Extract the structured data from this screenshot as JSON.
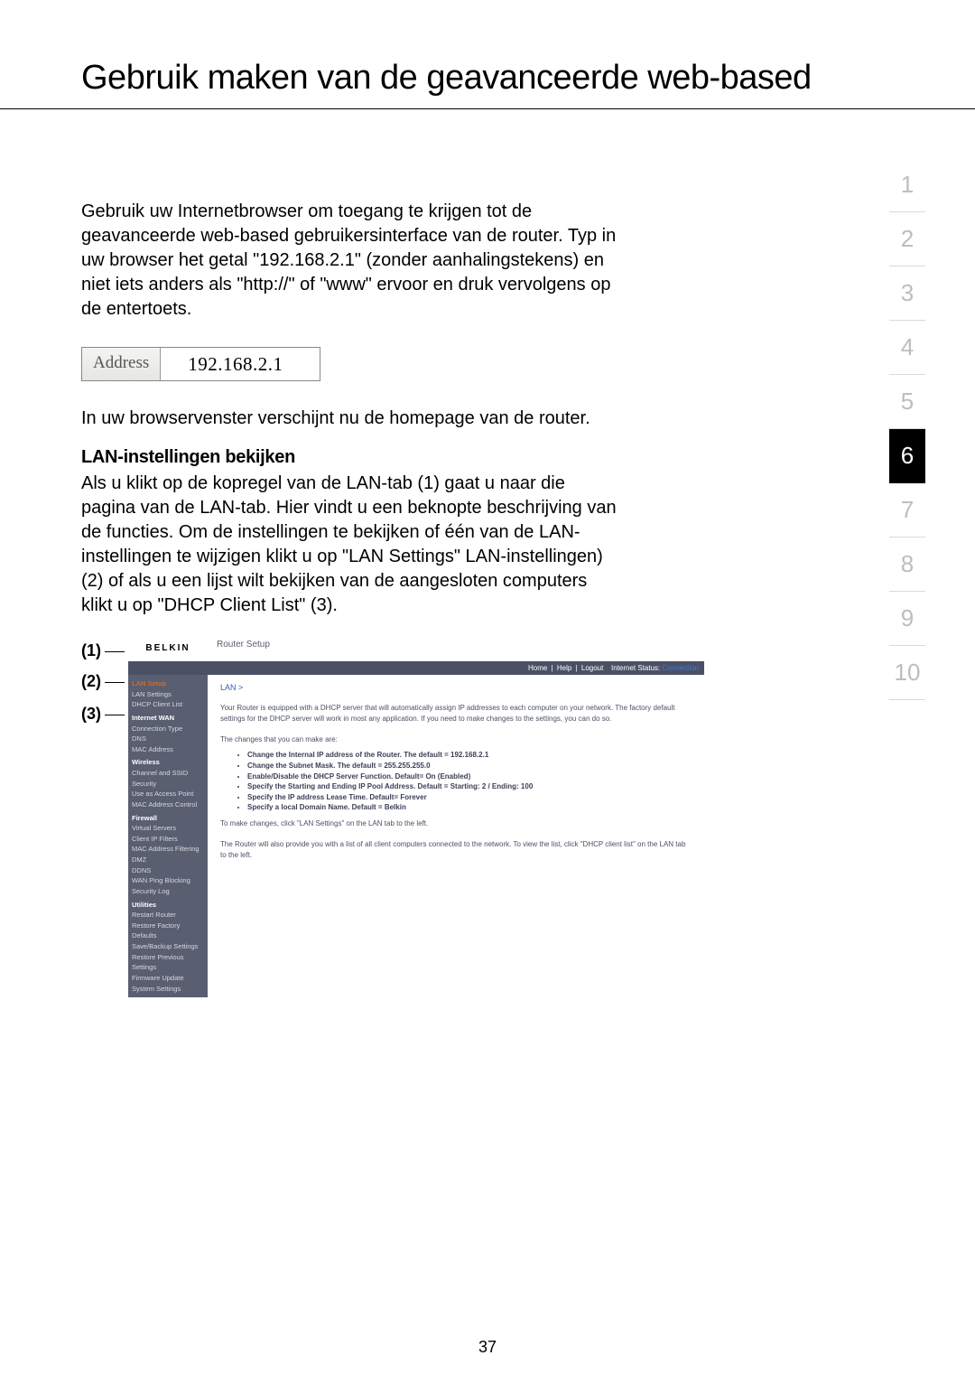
{
  "title": "Gebruik maken van de geavanceerde web-based",
  "intro": "Gebruik uw Internetbrowser om toegang te krijgen tot de geavanceerde web-based gebruikersinterface van de router. Typ in uw browser het getal \"192.168.2.1\" (zonder aanhalingstekens) en niet iets anders als \"http://\" of \"www\" ervoor en druk vervolgens op de entertoets.",
  "address_label": "Address",
  "address_value": "192.168.2.1",
  "after_address": "In uw browservenster verschijnt nu de homepage van de router.",
  "subhead": "LAN-instellingen bekijken",
  "lan_para": "Als u klikt op de kopregel van de LAN-tab (1) gaat u naar die pagina van de LAN-tab. Hier vindt u een beknopte beschrijving van de functies. Om de instellingen te bekijken of één van de LAN-instellingen te wijzigen klikt u op \"LAN Settings\" LAN-instellingen) (2) of als u een lijst wilt bekijken van de aangesloten computers klikt u op \"DHCP Client List\" (3).",
  "nav": [
    "1",
    "2",
    "3",
    "4",
    "5",
    "6",
    "7",
    "8",
    "9",
    "10"
  ],
  "nav_active_index": 5,
  "callouts": [
    "(1)",
    "(2)",
    "(3)"
  ],
  "router": {
    "logo": "BELKIN",
    "setup_title": "Router Setup",
    "topbar_links": [
      "Home",
      "Help",
      "Logout"
    ],
    "topbar_status_label": "Internet Status:",
    "topbar_status_value": "Connection",
    "crumb": "LAN >",
    "desc1": "Your Router is equipped with a DHCP server that will automatically assign IP addresses to each computer on your network. The factory default settings for the DHCP server will work in most any application. If you need to make changes to the settings, you can do so.",
    "desc2": "The changes that you can make are:",
    "bullets": [
      "Change the Internal IP address of the Router. The default = 192.168.2.1",
      "Change the Subnet Mask. The default = 255.255.255.0",
      "Enable/Disable the DHCP Server Function. Default= On (Enabled)",
      "Specify the Starting and Ending IP Pool Address. Default = Starting: 2 / Ending: 100",
      "Specify the IP address Lease Time. Default= Forever",
      "Specify a local Domain Name. Default = Belkin"
    ],
    "desc3": "To make changes, click \"LAN Settings\" on the LAN tab to the left.",
    "desc4": "The Router will also provide you with a list of all client computers connected to the network. To view the list, click \"DHCP client list\" on the LAN tab to the left.",
    "sidebar": {
      "lan_setup": "LAN Setup",
      "lan_settings": "LAN Settings",
      "dhcp_list": "DHCP Client List",
      "internet_wan": "Internet WAN",
      "conn_type": "Connection Type",
      "dns": "DNS",
      "mac": "MAC Address",
      "wireless": "Wireless",
      "chan_ssid": "Channel and SSID",
      "security": "Security",
      "use_ap": "Use as Access Point",
      "mac_ctrl": "MAC Address Control",
      "firewall": "Firewall",
      "virt": "Virtual Servers",
      "client_ip": "Client IP Filters",
      "mac_filter": "MAC Address Filtering",
      "dmz": "DMZ",
      "ddns": "DDNS",
      "wan_ping": "WAN Ping Blocking",
      "sec_log": "Security Log",
      "utilities": "Utilities",
      "restart": "Restart Router",
      "restore": "Restore Factory Defaults",
      "save": "Save/Backup Settings",
      "prev": "Restore Previous Settings",
      "fw": "Firmware Update",
      "sys": "System Settings"
    }
  },
  "page_number": "37"
}
